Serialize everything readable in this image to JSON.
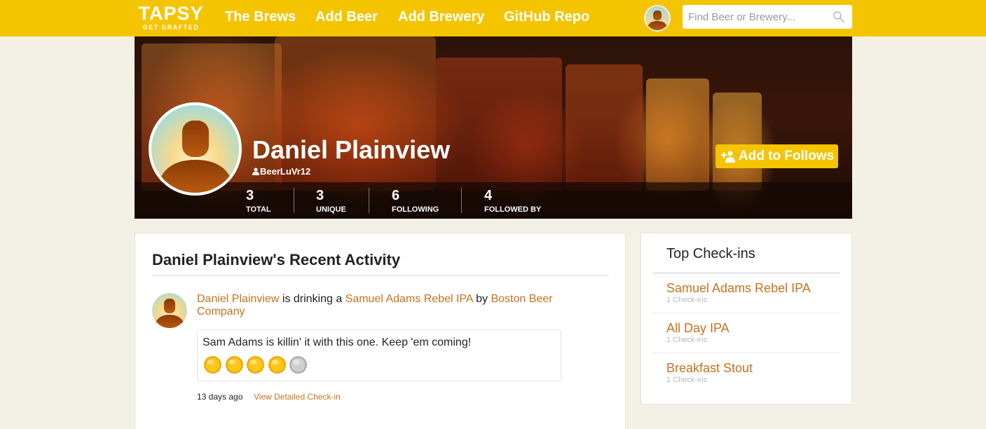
{
  "nav": {
    "logo_main": "TAPSY",
    "logo_sub": "GET DRAFTED",
    "links": [
      "The Brews",
      "Add Beer",
      "Add Brewery",
      "GitHub Repo"
    ],
    "search_placeholder": "Find Beer or Brewery..."
  },
  "profile": {
    "name": "Daniel Plainview",
    "handle": "BeerLuVr12",
    "follow_label": "Add to Follows",
    "stats": [
      {
        "value": "3",
        "label": "TOTAL"
      },
      {
        "value": "3",
        "label": "UNIQUE"
      },
      {
        "value": "6",
        "label": "FOLLOWING"
      },
      {
        "value": "4",
        "label": "FOLLOWED BY"
      }
    ]
  },
  "activity": {
    "title": "Daniel Plainview's Recent Activity",
    "items": [
      {
        "user": "Daniel Plainview",
        "verb": " is drinking a ",
        "beer": "Samuel Adams Rebel IPA",
        "by": " by ",
        "brewery": "Boston Beer Company",
        "comment": "Sam Adams is killin' it with this one. Keep 'em coming!",
        "rating": 4,
        "rating_max": 5,
        "time": "13 days ago",
        "detail_link": "View Detailed Check-in"
      }
    ]
  },
  "sidebar": {
    "title": "Top Check-ins",
    "items": [
      {
        "name": "Samuel Adams Rebel IPA",
        "count": "1 Check-ins"
      },
      {
        "name": "All Day IPA",
        "count": "1 Check-ins"
      },
      {
        "name": "Breakfast Stout",
        "count": "1 Check-ins"
      }
    ]
  },
  "colors": {
    "brand_yellow": "#f5c400",
    "link_orange": "#c8711f",
    "page_bg": "#f3f0e6"
  }
}
